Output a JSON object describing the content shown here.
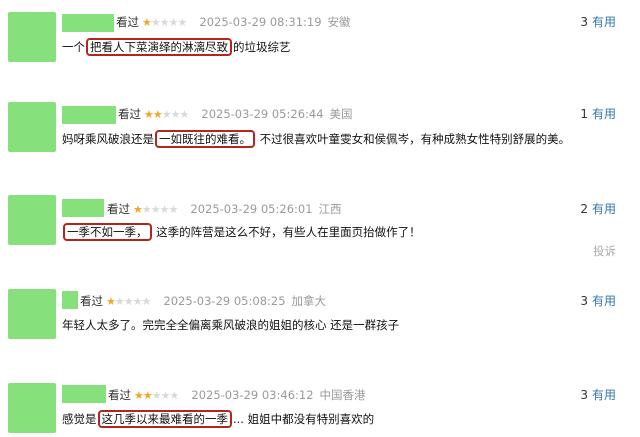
{
  "comments": [
    {
      "seen": "看过",
      "rating": 1,
      "time": "2025-03-29 08:31:19",
      "location": "安徽",
      "votes": "3",
      "useful": "有用",
      "pre": "一个",
      "highlight": "把看人下菜演绎的淋漓尽致",
      "post": "的垃圾综艺"
    },
    {
      "seen": "看过",
      "rating": 2,
      "time": "2025-03-29 05:26:44",
      "location": "美国",
      "votes": "1",
      "useful": "有用",
      "pre": "妈呀乘风破浪还是",
      "highlight": "一如既往的难看。",
      "post": " 不过很喜欢叶童雯女和侯佩岑，有种成熟女性特别舒展的美。"
    },
    {
      "seen": "看过",
      "rating": 1,
      "time": "2025-03-29 05:26:01",
      "location": "江西",
      "votes": "2",
      "useful": "有用",
      "pre": "",
      "highlight": "一季不如一季，",
      "post": " 这季的阵营是这么不好，有些人在里面页抬做作了！",
      "report": "投诉"
    },
    {
      "seen": "看过",
      "rating": 1,
      "time": "2025-03-29 05:08:25",
      "location": "加拿大",
      "votes": "3",
      "useful": "有用",
      "pre": "年轻人太多了。完完全全偏离乘风破浪的姐姐的核心 还是一群孩子",
      "highlight": "",
      "post": ""
    },
    {
      "seen": "看过",
      "rating": 2,
      "time": "2025-03-29 03:46:12",
      "location": "中国香港",
      "votes": "3",
      "useful": "有用",
      "pre": "感觉是",
      "highlight": "这几季以来最难看的一季",
      "post": "... 姐姐中都没有特别喜欢的"
    }
  ]
}
